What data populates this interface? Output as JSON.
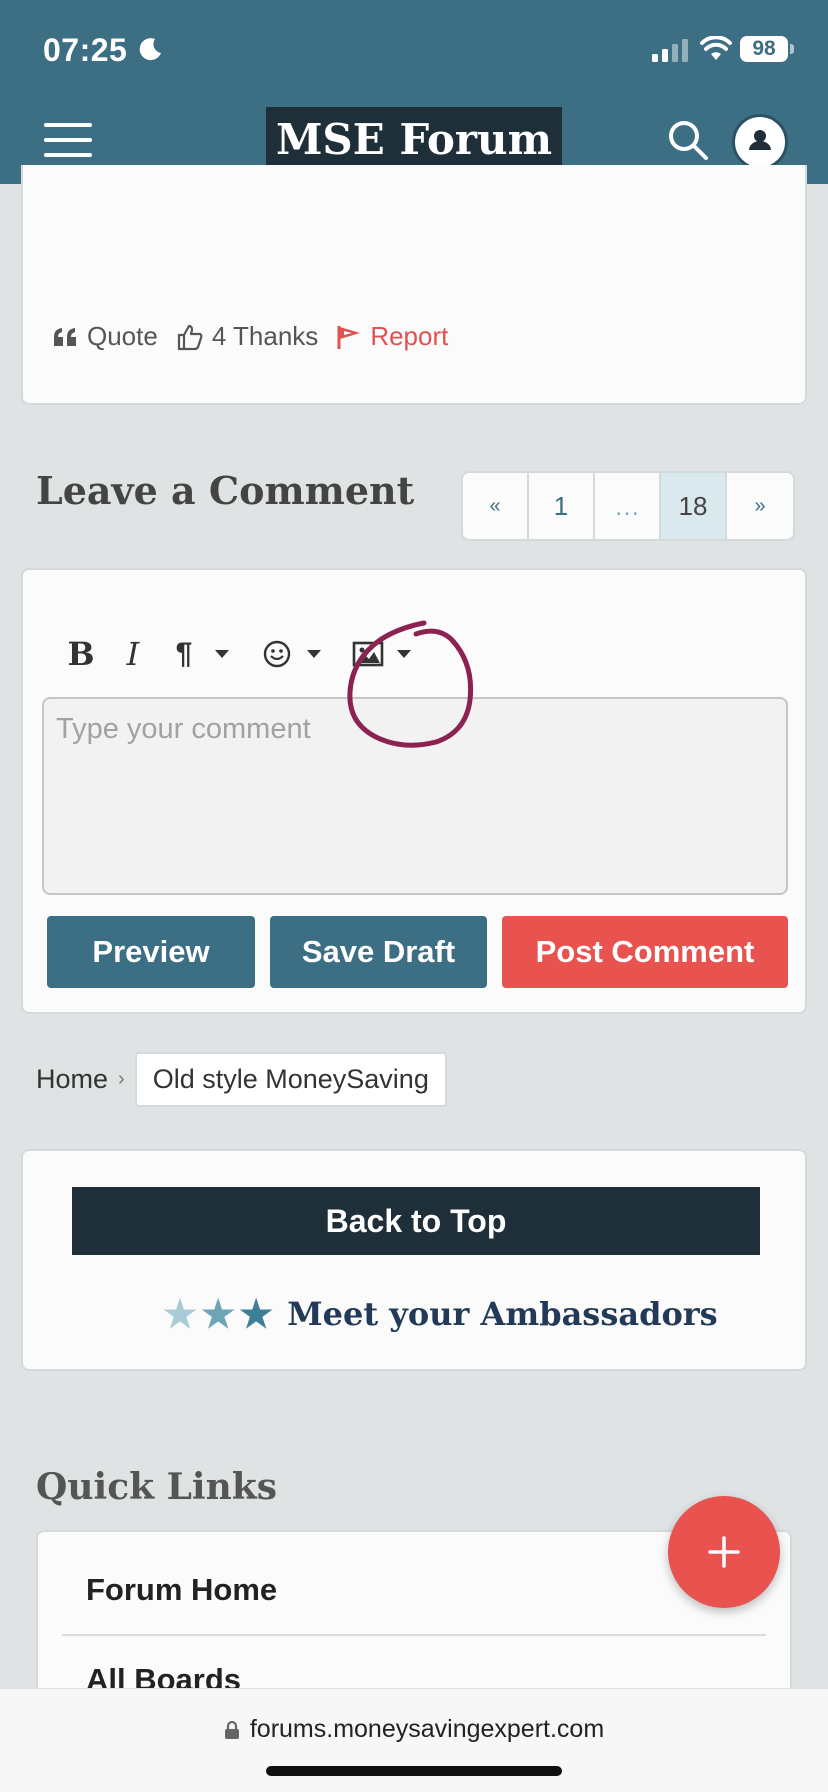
{
  "status_bar": {
    "time": "07:25",
    "battery": "98"
  },
  "header": {
    "logo": "MSE Forum"
  },
  "post": {
    "actions": {
      "quote": "Quote",
      "thanks": "4 Thanks",
      "report": "Report"
    }
  },
  "comment_section": {
    "heading": "Leave a Comment",
    "pagination": {
      "prev": "«",
      "first": "1",
      "ellipsis": "…",
      "current": "18",
      "next": "»"
    },
    "toolbar": {
      "bold": "B",
      "italic": "I",
      "paragraph": "¶"
    },
    "textarea_placeholder": "Type your comment",
    "buttons": {
      "preview": "Preview",
      "save_draft": "Save Draft",
      "post": "Post Comment"
    }
  },
  "breadcrumb": {
    "home": "Home",
    "separator": "›",
    "current": "Old style MoneySaving"
  },
  "footer_card": {
    "back_to_top": "Back to Top",
    "ambassadors": "Meet your Ambassadors"
  },
  "quick_links": {
    "heading": "Quick Links",
    "items": [
      "Forum Home",
      "All Boards"
    ]
  },
  "browser": {
    "url": "forums.moneysavingexpert.com"
  },
  "colors": {
    "brand_teal": "#3d6f84",
    "dark_navy": "#1e2f3a",
    "accent_red": "#e8534f",
    "annotation": "#8b2252"
  },
  "icons": [
    "moon-icon",
    "signal-icon",
    "wifi-icon",
    "battery-icon",
    "menu-icon",
    "search-icon",
    "user-icon",
    "quote-icon",
    "thumbs-up-icon",
    "flag-icon",
    "chevron-down-icon",
    "emoji-icon",
    "image-icon",
    "star-icon",
    "plus-icon",
    "lock-icon"
  ]
}
